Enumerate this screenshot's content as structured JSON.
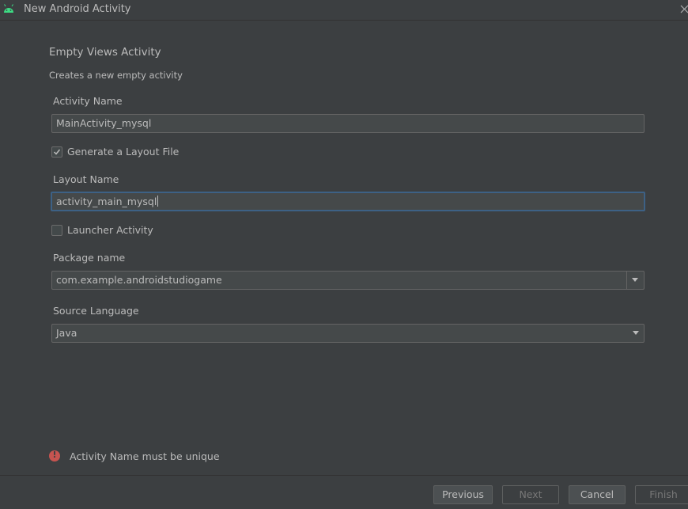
{
  "window": {
    "title": "New Android Activity",
    "icon": "android-icon"
  },
  "template": {
    "heading": "Empty Views Activity",
    "description": "Creates a new empty activity"
  },
  "form": {
    "activity_name_label": "Activity Name",
    "activity_name_value": "MainActivity_mysql",
    "generate_layout_label": "Generate a Layout File",
    "generate_layout_checked": true,
    "layout_name_label": "Layout Name",
    "layout_name_value": "activity_main_mysql",
    "launcher_activity_label": "Launcher Activity",
    "launcher_activity_checked": false,
    "package_name_label": "Package name",
    "package_name_value": "com.example.androidstudiogame",
    "source_language_label": "Source Language",
    "source_language_value": "Java"
  },
  "validation": {
    "error_message": "Activity Name must be unique",
    "icon": "error-icon"
  },
  "buttons": {
    "previous": "Previous",
    "next": "Next",
    "cancel": "Cancel",
    "finish": "Finish"
  },
  "colors": {
    "background": "#3c3f41",
    "field_bg": "#45494a",
    "focus_border": "#3d6185",
    "error": "#c75450",
    "android_green": "#3ddc84"
  }
}
